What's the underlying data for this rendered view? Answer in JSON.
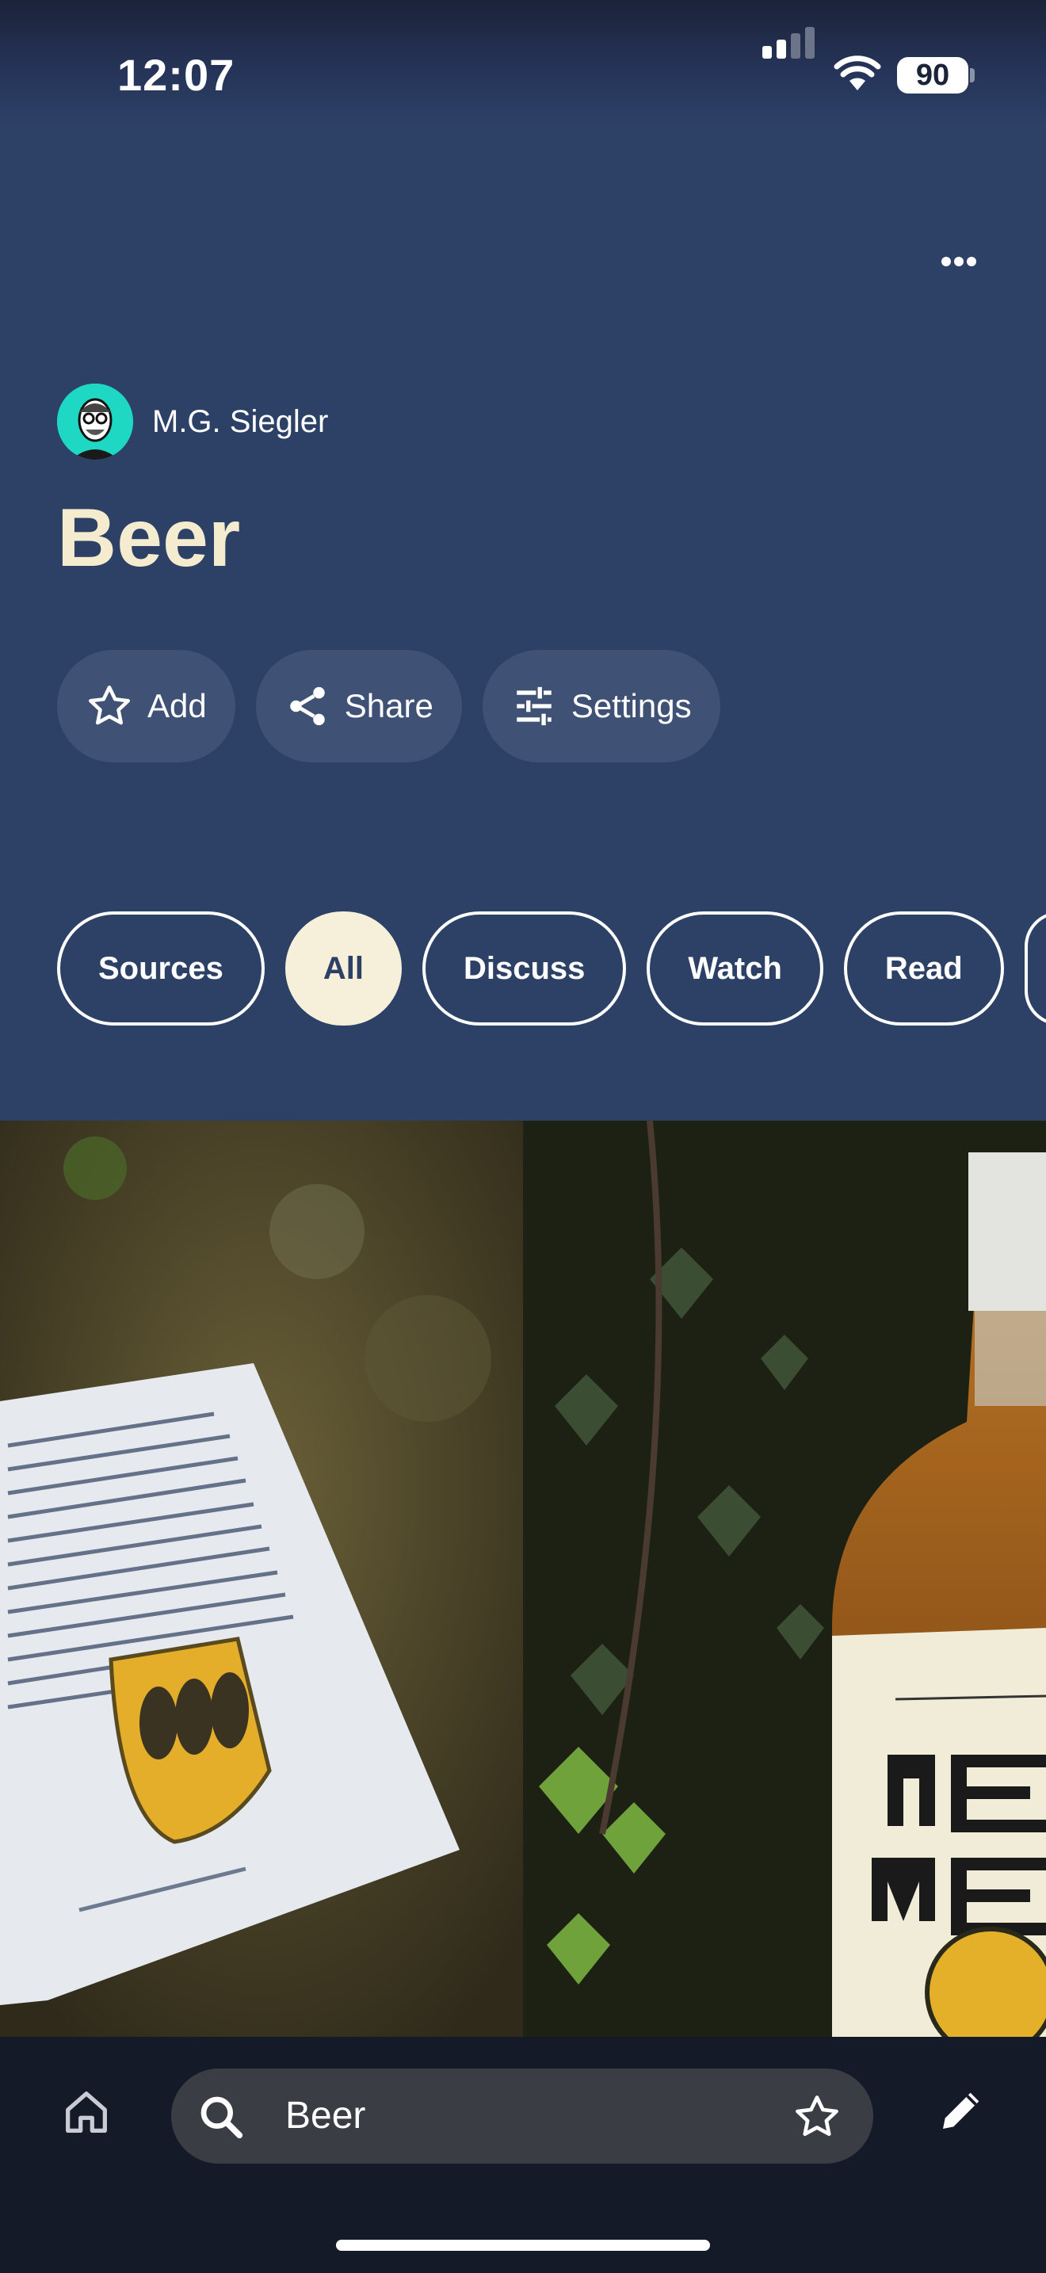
{
  "status_bar": {
    "time": "12:07",
    "battery": "90"
  },
  "header": {
    "author_name": "M.G. Siegler",
    "title": "Beer",
    "actions": [
      {
        "label": "Add",
        "icon": "star-outline-icon"
      },
      {
        "label": "Share",
        "icon": "share-icon"
      },
      {
        "label": "Settings",
        "icon": "sliders-icon"
      }
    ],
    "more_icon": "more-horizontal-icon"
  },
  "tabs": [
    {
      "label": "Sources",
      "active": false
    },
    {
      "label": "All",
      "active": true
    },
    {
      "label": "Discuss",
      "active": false
    },
    {
      "label": "Watch",
      "active": false
    },
    {
      "label": "Read",
      "active": false
    }
  ],
  "bottom_bar": {
    "search_value": "Beer",
    "icons": [
      "home-icon",
      "search-icon",
      "star-outline-icon",
      "pencil-icon"
    ]
  },
  "colors": {
    "header_bg": "#2d4166",
    "title": "#f5ecd0",
    "active_tab": "#f6f0da",
    "bottom_bg": "#151a28"
  }
}
